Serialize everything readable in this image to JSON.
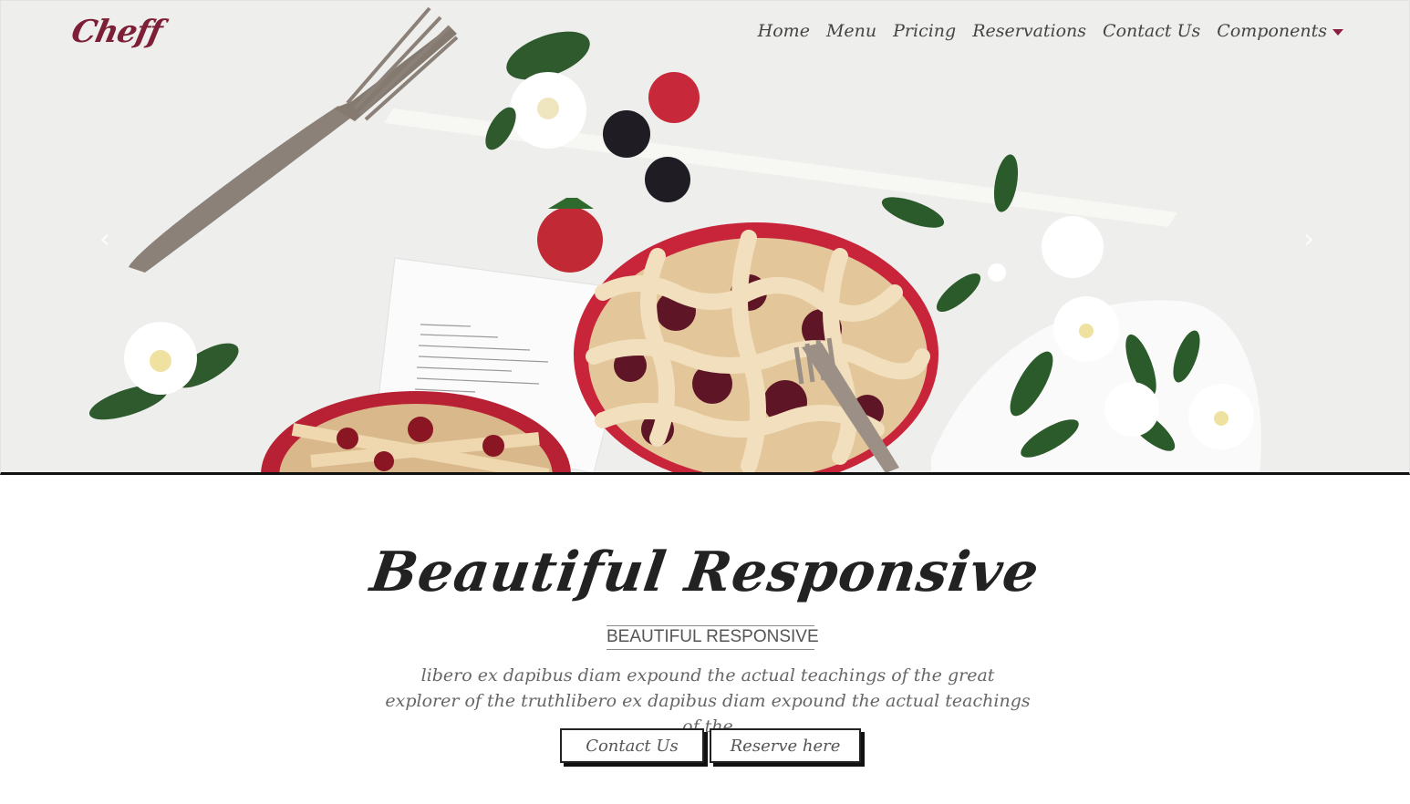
{
  "brand": {
    "logo_text": "Cheff",
    "accent_color": "#7d1f36"
  },
  "navbar": {
    "items": [
      {
        "label": "Home"
      },
      {
        "label": "Menu"
      },
      {
        "label": "Pricing"
      },
      {
        "label": "Reservations"
      },
      {
        "label": "Contact Us"
      },
      {
        "label": "Components",
        "has_dropdown": true
      }
    ]
  },
  "carousel": {
    "prev_icon": "chevron-left-icon",
    "next_icon": "chevron-right-icon"
  },
  "hero": {
    "title": "Beautiful Responsive",
    "subtitle": "BEAUTIFUL RESPONSIVE",
    "description": "libero ex dapibus diam expound the actual teachings of the great explorer of the truthlibero ex dapibus diam expound the actual teachings of the",
    "buttons": {
      "contact_label": "Contact Us",
      "reserve_label": "Reserve here"
    }
  }
}
